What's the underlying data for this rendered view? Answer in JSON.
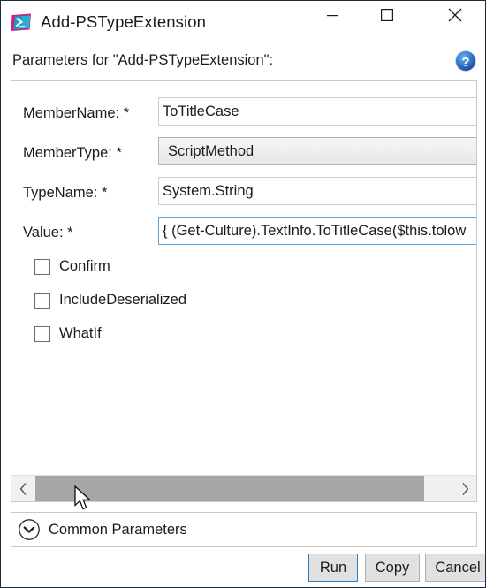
{
  "window": {
    "title": "Add-PSTypeExtension",
    "icon": "powershell-icon",
    "controls": {
      "minimize": "minimize-icon",
      "maximize": "maximize-icon",
      "close": "close-icon"
    }
  },
  "header": {
    "text": "Parameters for \"Add-PSTypeExtension\":",
    "help_icon": "help-icon"
  },
  "fields": [
    {
      "label": "MemberName:",
      "required_marker": "*",
      "value": "ToTitleCase",
      "placeholder": "",
      "kind": "text",
      "focused": false
    },
    {
      "label": "MemberType:",
      "required_marker": "*",
      "value": "ScriptMethod",
      "placeholder": "",
      "kind": "combobox",
      "focused": false
    },
    {
      "label": "TypeName:",
      "required_marker": "*",
      "value": "System.String",
      "placeholder": "",
      "kind": "text",
      "focused": false
    },
    {
      "label": "Value:",
      "required_marker": "*",
      "value": "{ (Get-Culture).TextInfo.ToTitleCase($this.tolow",
      "placeholder": "",
      "kind": "text",
      "focused": true
    }
  ],
  "checkboxes": [
    {
      "label": "Confirm",
      "checked": false
    },
    {
      "label": "IncludeDeserialized",
      "checked": false
    },
    {
      "label": "WhatIf",
      "checked": false
    }
  ],
  "scrollbar": {
    "left_arrow": "chevron-left-icon",
    "right_arrow": "chevron-right-icon",
    "orientation": "horizontal"
  },
  "common_parameters": {
    "label": "Common Parameters",
    "chevron_icon": "chevron-down-circle-icon",
    "expanded": false
  },
  "footer": {
    "run_label": "Run",
    "copy_label": "Copy",
    "cancel_label": "Cancel",
    "default_button": "Run"
  },
  "colors": {
    "accent_focus": "#0078D7",
    "button_face": "#E1E1E1",
    "button_border": "#ADADAD",
    "panel_border": "#C8C8C8",
    "scroll_thumb": "#A6A6A6",
    "scroll_track": "#F0F0F0",
    "text": "#1B1B1B",
    "icon_magenta": "#C9208A",
    "icon_cyan": "#2AAFD4",
    "help_blue": "#1C5FB0"
  }
}
